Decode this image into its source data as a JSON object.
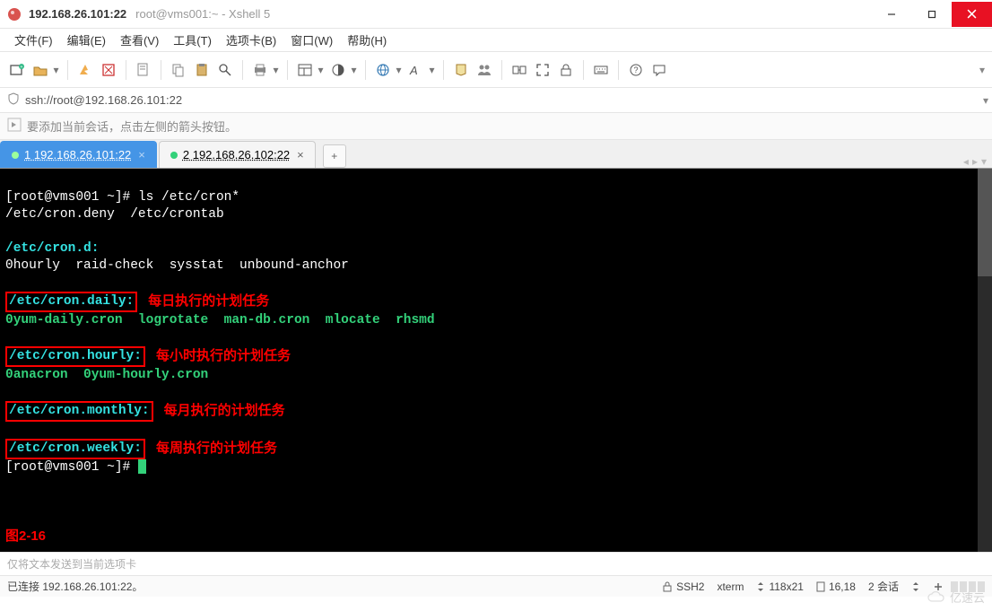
{
  "titlebar": {
    "ip": "192.168.26.101:22",
    "sub": "root@vms001:~ - Xshell 5"
  },
  "menu": {
    "file": "文件(F)",
    "edit": "编辑(E)",
    "view": "查看(V)",
    "tools": "工具(T)",
    "tab": "选项卡(B)",
    "window": "窗口(W)",
    "help": "帮助(H)"
  },
  "addressbar": {
    "url": "ssh://root@192.168.26.101:22"
  },
  "hintbar": {
    "text": "要添加当前会话，点击左侧的箭头按钮。"
  },
  "tabs": [
    {
      "label": "1 192.168.26.101:22",
      "active": true
    },
    {
      "label": "2 192.168.26.102:22",
      "active": false
    }
  ],
  "terminal": {
    "prompt1": "[root@vms001 ~]# ",
    "cmd1": "ls /etc/cron*",
    "line_deny": "/etc/cron.deny  /etc/crontab",
    "cron_d_hdr": "/etc/cron.d:",
    "cron_d_list": "0hourly  raid-check  sysstat  unbound-anchor",
    "daily_hdr": "/etc/cron.daily:",
    "daily_anno": "每日执行的计划任务",
    "daily_list": "0yum-daily.cron  logrotate  man-db.cron  mlocate  rhsmd",
    "hourly_hdr": "/etc/cron.hourly:",
    "hourly_anno": "每小时执行的计划任务",
    "hourly_list": "0anacron  0yum-hourly.cron",
    "monthly_hdr": "/etc/cron.monthly:",
    "monthly_anno": "每月执行的计划任务",
    "weekly_hdr": "/etc/cron.weekly:",
    "weekly_anno": "每周执行的计划任务",
    "prompt2": "[root@vms001 ~]# ",
    "figure": "图2-16"
  },
  "bottombar": {
    "placeholder": "仅将文本发送到当前选项卡"
  },
  "statusbar": {
    "conn": "已连接 192.168.26.101:22。",
    "proto": "SSH2",
    "term": "xterm",
    "size": "118x21",
    "pos": "16,18",
    "sessions": "2 会话"
  },
  "watermark": "亿速云"
}
